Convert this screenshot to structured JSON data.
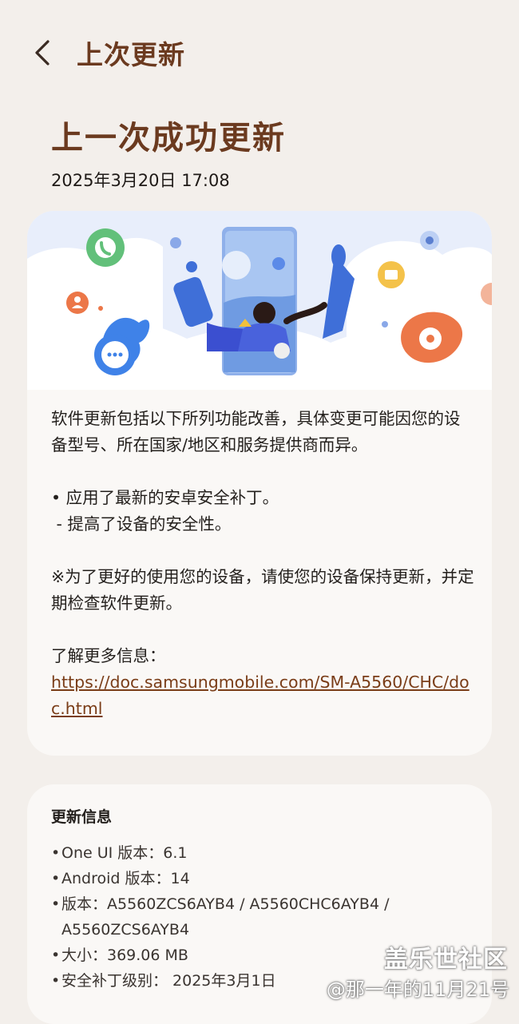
{
  "header": {
    "title": "上次更新"
  },
  "main": {
    "title": "上一次成功更新",
    "date": "2025年3月20日 17:08"
  },
  "notes": {
    "intro": "软件更新包括以下所列功能改善，具体变更可能因您的设备型号、所在国家/地区和服务提供商而异。",
    "bullet1": "• 应用了最新的安卓安全补丁。",
    "sub1": " - 提高了设备的安全性。",
    "tip": "※为了更好的使用您的设备，请使您的设备保持更新，并定期检查软件更新。",
    "more_label": "了解更多信息：",
    "link": "https://doc.samsungmobile.com/SM-A5560/CHC/doc.html"
  },
  "info": {
    "title": "更新信息",
    "items": [
      "One UI 版本：6.1",
      "Android 版本：14",
      "版本：A5560ZCS6AYB4 / A5560CHC6AYB4 / A5560ZCS6AYB4",
      "大小：369.06 MB",
      "安全补丁级别： 2025年3月1日"
    ]
  },
  "watermark": {
    "line1": "盖乐世社区",
    "line2": "@那一年的11月21号"
  },
  "icons": [
    "back-arrow-icon",
    "phone-icon",
    "person-icon",
    "chat-icon",
    "settings-icon",
    "folder-icon",
    "flower-icon"
  ],
  "colors": {
    "title": "#6b3a1f",
    "link": "#7a3d18",
    "background": "#f3efeb",
    "card": "#faf8f6"
  }
}
